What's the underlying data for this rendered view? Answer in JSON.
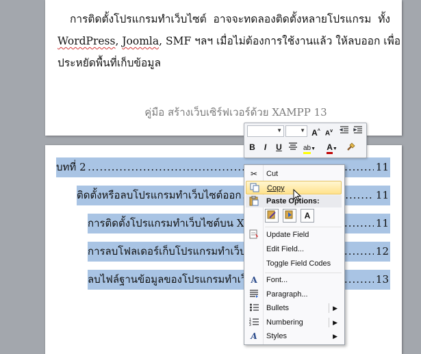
{
  "document": {
    "paragraph_lines": [
      [
        "การติดตั้งโปรแกรมทำเว็บไซต์",
        "อาจจะทดลองติดตั้งหลายโปรแกรม",
        "ทั้ง"
      ],
      [
        "WordPress, Joomla, SMF ฯลฯ เมื่อไม่ต้องการใช้งานแล้ว ให้ลบออก เพื่อ"
      ],
      [
        "ประหยัดพื้นที่เก็บข้อมูล"
      ]
    ],
    "wavy_words": [
      "WordPress",
      "Joomla"
    ],
    "footer": "คู่มือ สร้างเว็บเซิร์ฟเวอร์ด้วย XAMPP  13",
    "toc": [
      {
        "text": "บทที่ 2",
        "page": "11"
      },
      {
        "text": "ติดตั้งหรือลบโปรแกรมทำเว็บไซต์ออก",
        "page": "11"
      },
      {
        "text": "การติดตั้งโปรแกรมทำเว็บไซต์บน Xampp",
        "page": "11"
      },
      {
        "text": "การลบโฟลเดอร์เก็บโปรแกรมทำเว็บไซต์",
        "page": "12"
      },
      {
        "text": "ลบไฟล์ฐานข้อมูลของโปรแกรมทำเว็บไซต์",
        "page": "13"
      }
    ]
  },
  "mini_toolbar": {
    "font_name": "",
    "font_size": "",
    "row1_icons": [
      "grow-font-icon",
      "shrink-font-icon",
      "decrease-indent-icon",
      "increase-indent-icon"
    ],
    "bold": "B",
    "italic": "I",
    "underline": "U",
    "grow_font": "A",
    "shrink_font": "A",
    "font_color_letter": "A",
    "highlight_letter": "ab",
    "colors": {
      "highlight": "#ffff00",
      "font_color": "#c00000"
    }
  },
  "context_menu": {
    "cut": "Cut",
    "copy": "Copy",
    "paste_options": "Paste Options:",
    "update_field": "Update Field",
    "edit_field": "Edit Field...",
    "toggle_field_codes": "Toggle Field Codes",
    "font": "Font...",
    "paragraph": "Paragraph...",
    "bullets": "Bullets",
    "numbering": "Numbering",
    "styles": "Styles",
    "paste_a": "A",
    "highlighted": "Copy"
  },
  "colors": {
    "selection": "#a9c4e4",
    "workspace": "#a3a7ad",
    "highlight": "#ffe28c"
  }
}
